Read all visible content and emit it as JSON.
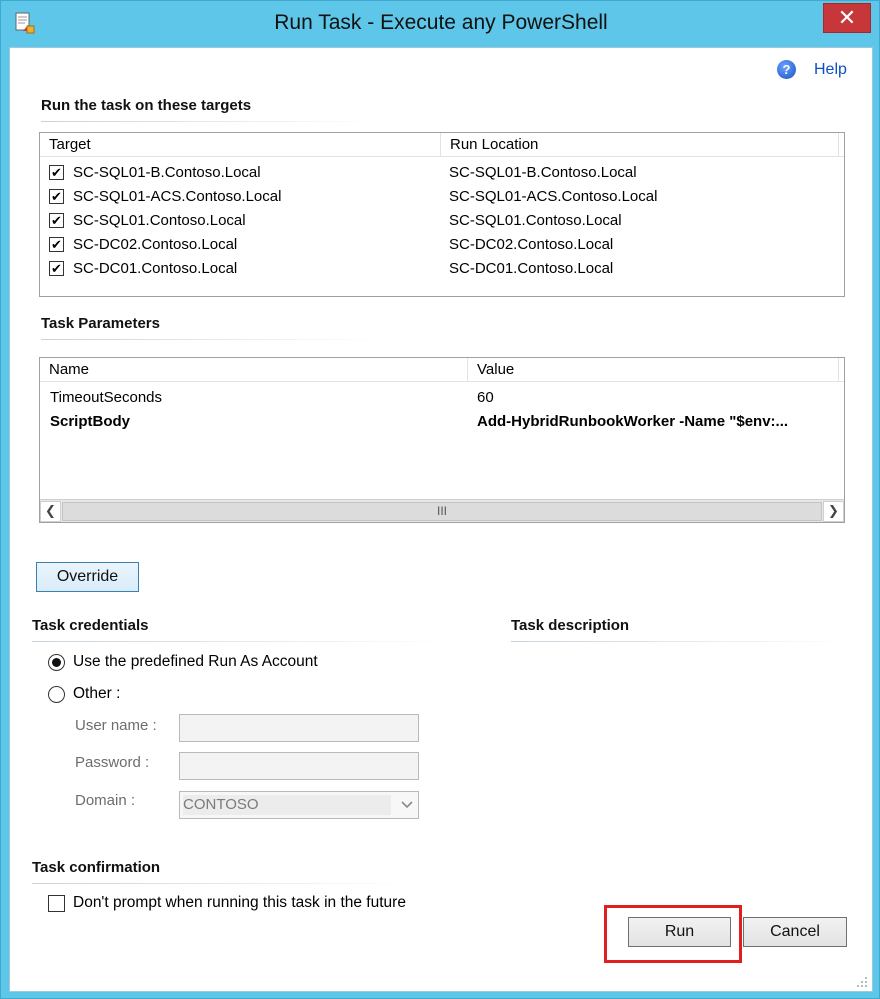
{
  "window": {
    "title": "Run Task - Execute any PowerShell"
  },
  "help": {
    "label": "Help"
  },
  "targets": {
    "heading": "Run the task on these targets",
    "columns": [
      "Target",
      "Run Location"
    ],
    "rows": [
      {
        "target": "SC-SQL01-B.Contoso.Local",
        "location": "SC-SQL01-B.Contoso.Local",
        "checked": true
      },
      {
        "target": "SC-SQL01-ACS.Contoso.Local",
        "location": "SC-SQL01-ACS.Contoso.Local",
        "checked": true
      },
      {
        "target": "SC-SQL01.Contoso.Local",
        "location": "SC-SQL01.Contoso.Local",
        "checked": true
      },
      {
        "target": "SC-DC02.Contoso.Local",
        "location": "SC-DC02.Contoso.Local",
        "checked": true
      },
      {
        "target": "SC-DC01.Contoso.Local",
        "location": "SC-DC01.Contoso.Local",
        "checked": true
      }
    ]
  },
  "parameters": {
    "heading": "Task Parameters",
    "columns": [
      "Name",
      "Value"
    ],
    "rows": [
      {
        "name": "TimeoutSeconds",
        "value": "60",
        "bold": false
      },
      {
        "name": "ScriptBody",
        "value": "Add-HybridRunbookWorker -Name \"$env:...",
        "bold": true
      }
    ],
    "scroll_thumb_glyph": "III"
  },
  "override_button": "Override",
  "credentials": {
    "heading": "Task credentials",
    "option_predefined": "Use the predefined Run As Account",
    "option_other": "Other :",
    "selected": "predefined",
    "username_label": "User name :",
    "username_value": "",
    "password_label": "Password :",
    "password_value": "",
    "domain_label": "Domain :",
    "domain_value": "CONTOSO"
  },
  "description": {
    "heading": "Task description"
  },
  "confirmation": {
    "heading": "Task confirmation",
    "dont_prompt_label": "Don't prompt when running this task in the future",
    "dont_prompt_checked": false
  },
  "buttons": {
    "run": "Run",
    "cancel": "Cancel"
  },
  "colors": {
    "titlebar": "#5ec6e8",
    "close": "#c7373a",
    "highlight": "#e02020",
    "link": "#0d4fc8"
  },
  "icons": {
    "app": "task-icon",
    "close": "close-icon",
    "help": "help-icon",
    "check": "checkmark-icon",
    "scroll_left": "chevron-left-icon",
    "scroll_right": "chevron-right-icon",
    "dropdown": "chevron-down-icon",
    "grip": "resize-grip-icon"
  }
}
